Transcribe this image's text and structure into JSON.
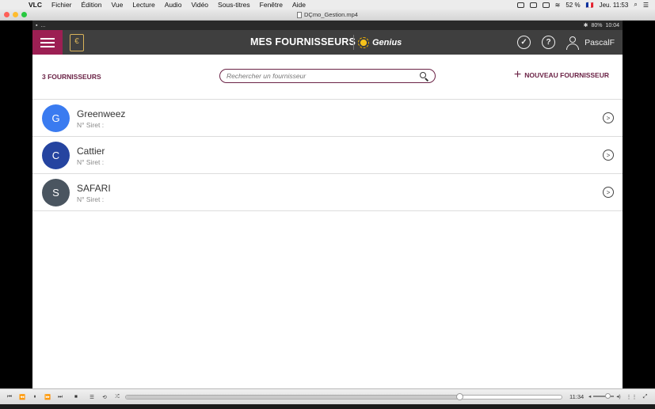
{
  "menubar": {
    "apple": "",
    "app": "VLC",
    "items": [
      "Fichier",
      "Édition",
      "Vue",
      "Lecture",
      "Audio",
      "Vidéo",
      "Sous-titres",
      "Fenêtre",
      "Aide"
    ],
    "battery": "52 %",
    "flag": "🇫🇷",
    "clock": "Jeu. 11:53"
  },
  "window": {
    "title": "DÇmo_Gestion.mp4",
    "lights": [
      "#fe5f57",
      "#febc2e",
      "#28c840"
    ]
  },
  "device_status": {
    "left": "...",
    "battery": "80%",
    "time": "10:04"
  },
  "appbar": {
    "title": "MES FOURNISSEURS",
    "brand": "Genius",
    "user": "PascalF",
    "logo_char": "€",
    "help_char": "?",
    "check_char": "✓"
  },
  "toolbar": {
    "count": "3 FOURNISSEURS",
    "search_placeholder": "Rechercher un fournisseur",
    "new_label": "NOUVEAU FOURNISSEUR",
    "plus": "+"
  },
  "suppliers": [
    {
      "initial": "G",
      "name": "Greenweez",
      "siret": "N° Siret :",
      "color": "#3a7bf0"
    },
    {
      "initial": "C",
      "name": "Cattier",
      "siret": "N° Siret :",
      "color": "#2544a0"
    },
    {
      "initial": "S",
      "name": "SAFARI",
      "siret": "N° Siret :",
      "color": "#4a5560"
    }
  ],
  "chevron": ">",
  "player": {
    "time": "11:34",
    "progress": 0.765,
    "volume": 0.7,
    "buttons": [
      "⏮",
      "⏪",
      "⏸",
      "⏩",
      "⏭",
      "■",
      "☰",
      "⟲",
      "⤮"
    ],
    "right_buttons": [
      "⋮⋮",
      "⤢"
    ]
  }
}
